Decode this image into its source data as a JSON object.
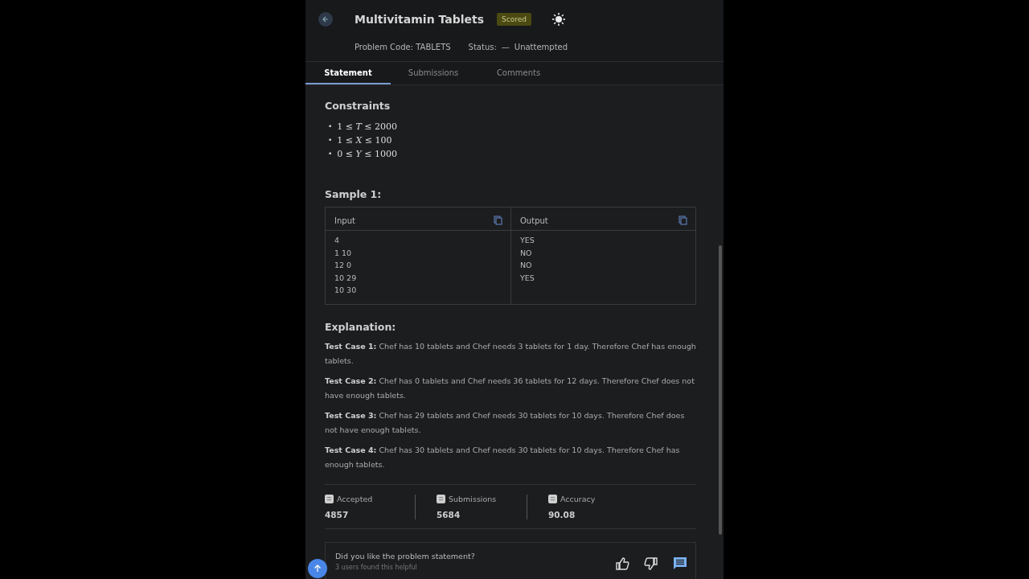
{
  "header": {
    "title": "Multivitamin Tablets",
    "badge": "Scored",
    "problem_code": "Problem Code: TABLETS",
    "status_label": "Status:",
    "status_dash": "—",
    "status_value": "Unattempted"
  },
  "tabs": [
    {
      "label": "Statement",
      "selected": true
    },
    {
      "label": "Submissions",
      "selected": false
    },
    {
      "label": "Comments",
      "selected": false
    }
  ],
  "constraints": {
    "heading": "Constraints",
    "bullet": "•",
    "items": [
      "1 ≤ *T* ≤ 2000",
      "1 ≤ *X* ≤ 100",
      "0 ≤ *Y* ≤ 1000"
    ]
  },
  "sample": {
    "heading": "Sample 1:",
    "input_label": "Input",
    "output_label": "Output",
    "input_lines": [
      "4",
      "1 10",
      "12 0",
      "10 29",
      "10 30"
    ],
    "output_lines": [
      "YES",
      "NO",
      "NO",
      "YES"
    ]
  },
  "explanation": {
    "heading": "Explanation:",
    "paragraphs": [
      "**Test Case 1:** Chef has 10 tablets and Chef needs 3 tablets for 1 day. Therefore Chef has enough tablets.",
      "**Test Case 2:** Chef has 0 tablets and Chef needs 36 tablets for 12 days. Therefore Chef does not have enough tablets.",
      "**Test Case 3:** Chef has 29 tablets and Chef needs 30 tablets for 10 days. Therefore Chef does not have enough tablets.",
      "**Test Case 4:** Chef has 30 tablets and Chef needs 30 tablets for 10 days. Therefore Chef has enough tablets."
    ]
  },
  "stats": [
    {
      "label": "Accepted",
      "value": "4857"
    },
    {
      "label": "Submissions",
      "value": "5684"
    },
    {
      "label": "Accuracy",
      "value": "90.08"
    }
  ],
  "feedback": {
    "question": "Did you like the problem statement?",
    "helpful": "3 users found this helpful"
  }
}
